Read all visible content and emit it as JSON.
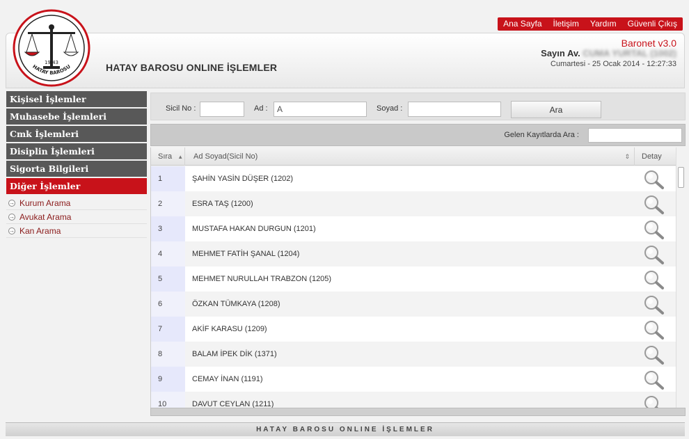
{
  "header": {
    "site_title": "HATAY BAROSU ONLINE İŞLEMLER",
    "logo_text": "HATAY BAROSU",
    "logo_year": "19 43",
    "version": "Baronet v3.0",
    "user_prefix": "Sayın Av.",
    "user_name": "CUMA YURTAL (1002)",
    "datetime": "Cumartesi - 25 Ocak 2014 - 12:27:33",
    "nav": [
      "Ana Sayfa",
      "İletişim",
      "Yardım",
      "Güvenli Çıkış"
    ],
    "accent": "#c8121a"
  },
  "sidebar": {
    "menu": [
      {
        "label": "Kişisel İşlemler",
        "active": false
      },
      {
        "label": "Muhasebe İşlemleri",
        "active": false
      },
      {
        "label": "Cmk İşlemleri",
        "active": false
      },
      {
        "label": "Disiplin İşlemleri",
        "active": false
      },
      {
        "label": "Sigorta Bilgileri",
        "active": false
      },
      {
        "label": "Diğer İşlemler",
        "active": true
      }
    ],
    "sub_items": [
      "Kurum Arama",
      "Avukat Arama",
      "Kan Arama"
    ]
  },
  "search": {
    "sicil_label": "Sicil No :",
    "sicil_value": "",
    "ad_label": "Ad :",
    "ad_value": "A",
    "soyad_label": "Soyad :",
    "soyad_value": "",
    "button_label": "Ara",
    "filter_label": "Gelen Kayıtlarda Ara :",
    "filter_value": ""
  },
  "table": {
    "col_no": "Sıra",
    "col_name": "Ad Soyad(Sicil No)",
    "col_detail": "Detay",
    "rows": [
      {
        "no": "1",
        "name": "ŞAHİN YASİN DÜŞER (1202)"
      },
      {
        "no": "2",
        "name": "ESRA TAŞ (1200)"
      },
      {
        "no": "3",
        "name": "MUSTAFA HAKAN DURGUN (1201)"
      },
      {
        "no": "4",
        "name": "MEHMET FATİH ŞANAL (1204)"
      },
      {
        "no": "5",
        "name": "MEHMET NURULLAH TRABZON (1205)"
      },
      {
        "no": "6",
        "name": "ÖZKAN TÜMKAYA (1208)"
      },
      {
        "no": "7",
        "name": "AKİF KARASU (1209)"
      },
      {
        "no": "8",
        "name": "BALAM İPEK DİK (1371)"
      },
      {
        "no": "9",
        "name": "CEMAY İNAN (1191)"
      },
      {
        "no": "10",
        "name": "DAVUT CEYLAN (1211)"
      }
    ]
  },
  "footer": {
    "text": "HATAY BAROSU ONLINE İŞLEMLER"
  }
}
